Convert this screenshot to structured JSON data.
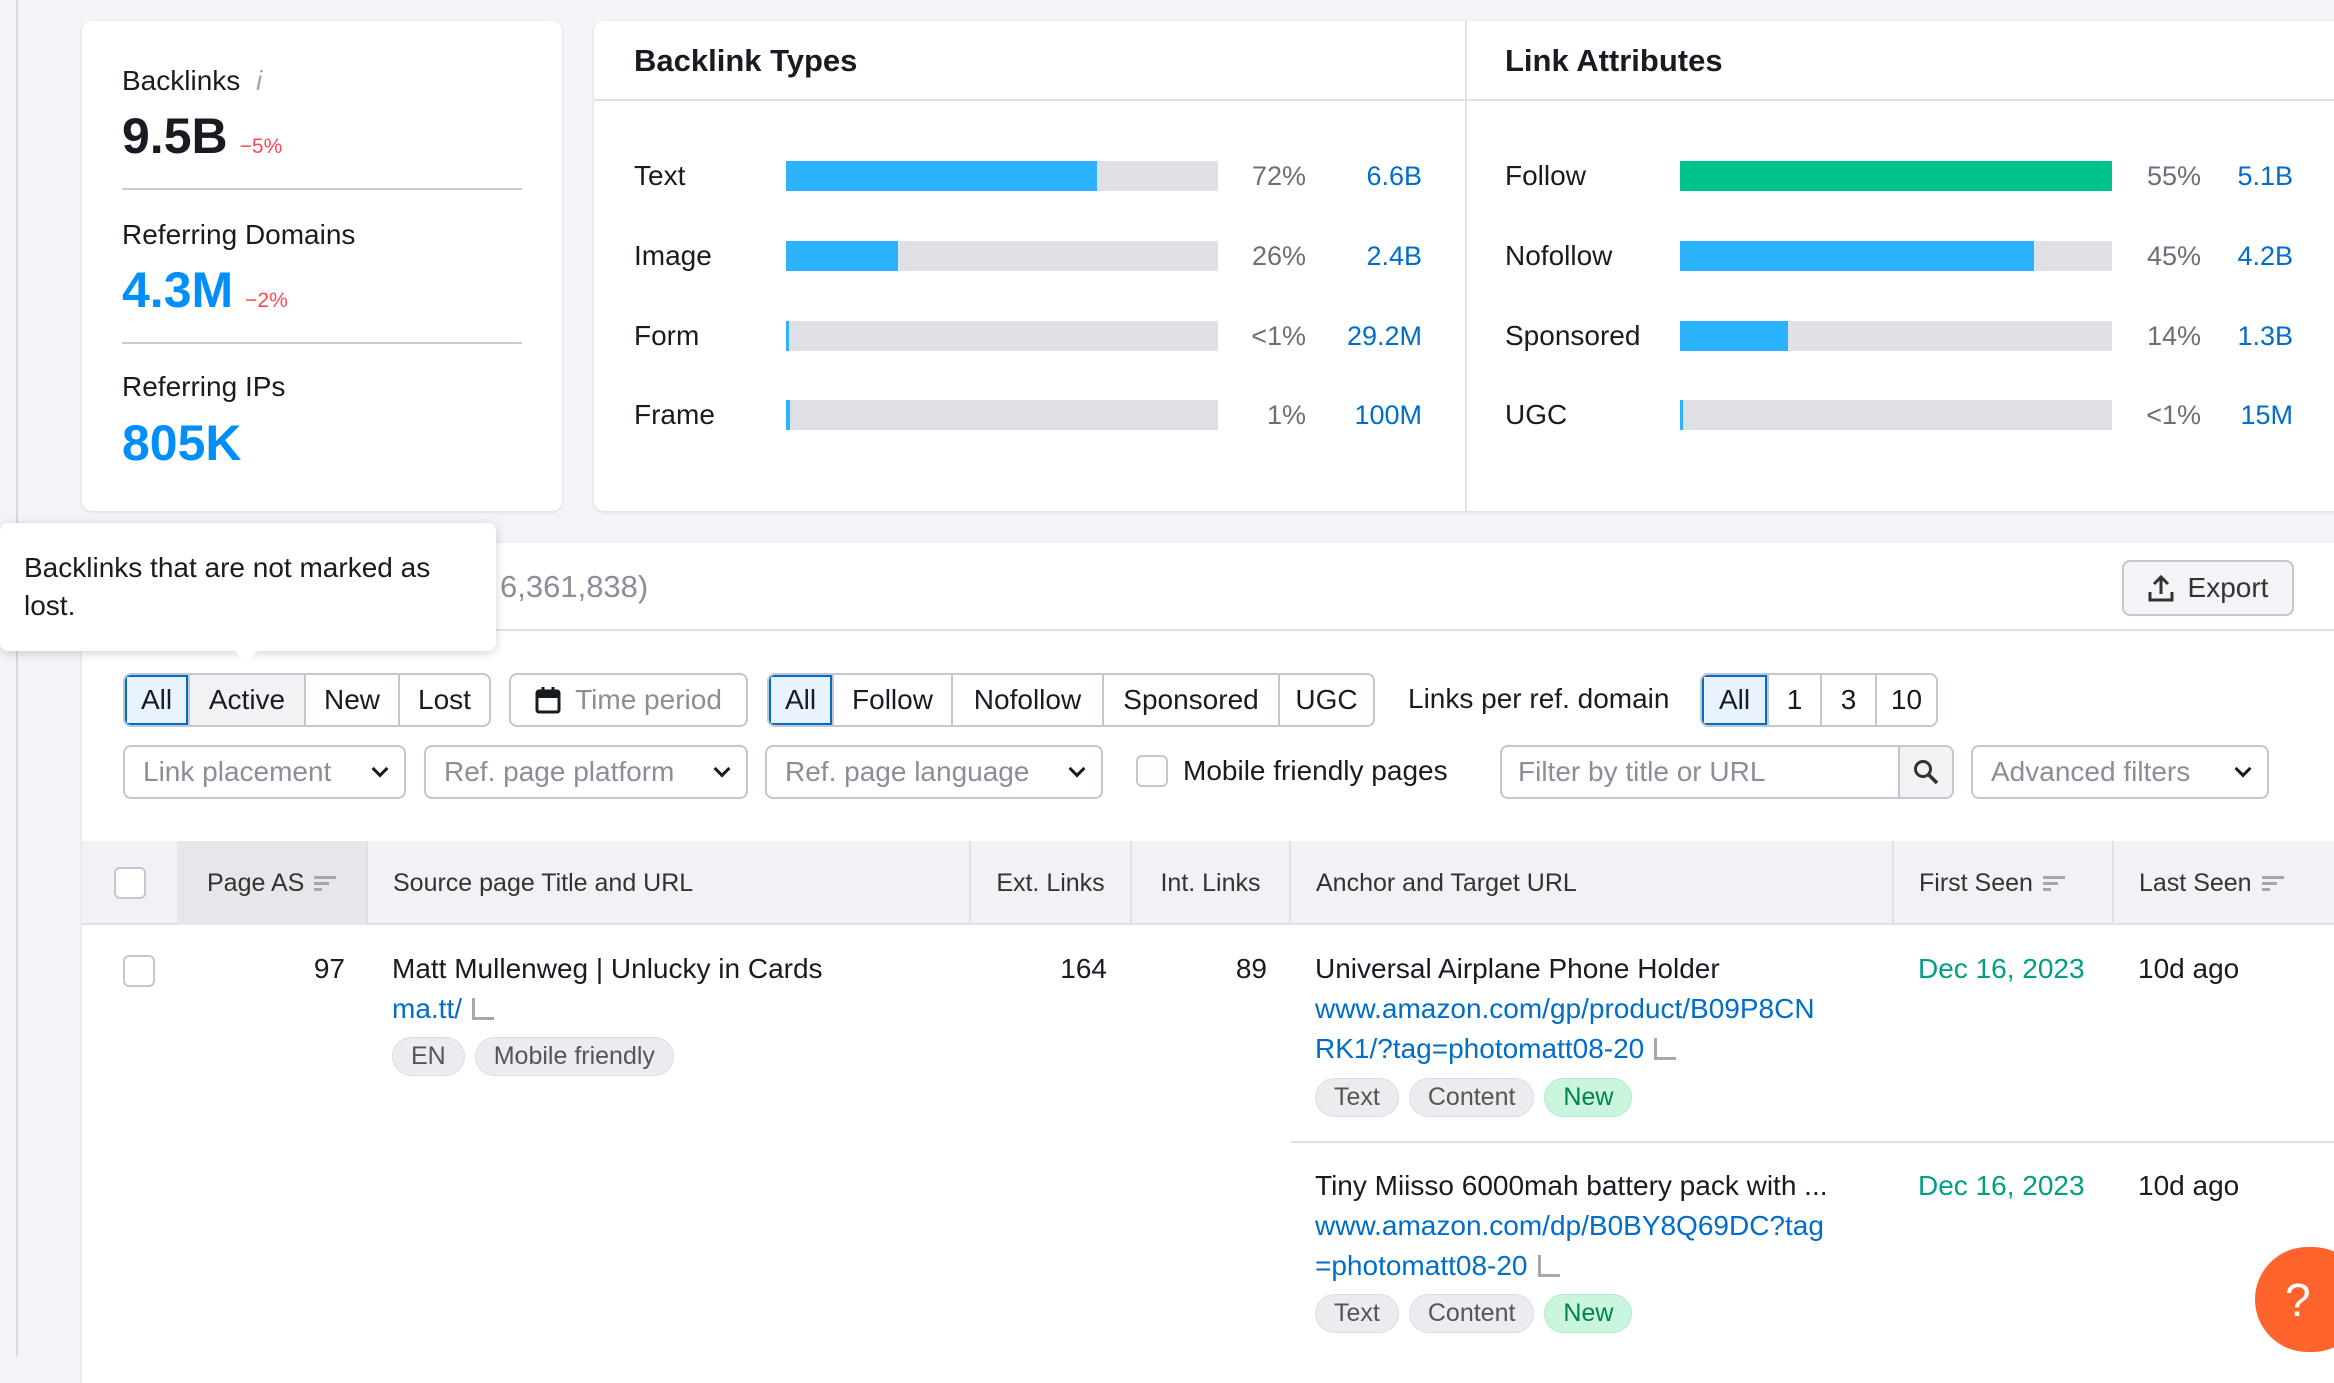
{
  "summary": {
    "backlinks": {
      "label": "Backlinks",
      "value": "9.5B",
      "delta": "−5%"
    },
    "referring_domains": {
      "label": "Referring Domains",
      "value": "4.3M",
      "delta": "−2%"
    },
    "referring_ips": {
      "label": "Referring IPs",
      "value": "805K"
    }
  },
  "backlink_types": {
    "title": "Backlink Types",
    "rows": [
      {
        "label": "Text",
        "percent_label": "72%",
        "value": "6.6B",
        "fill": 72
      },
      {
        "label": "Image",
        "percent_label": "26%",
        "value": "2.4B",
        "fill": 26
      },
      {
        "label": "Form",
        "percent_label": "<1%",
        "value": "29.2M",
        "fill": 0.5
      },
      {
        "label": "Frame",
        "percent_label": "1%",
        "value": "100M",
        "fill": 1
      }
    ]
  },
  "link_attributes": {
    "title": "Link Attributes",
    "rows": [
      {
        "label": "Follow",
        "percent_label": "55%",
        "value": "5.1B",
        "fill": 100,
        "color": "#00c38a"
      },
      {
        "label": "Nofollow",
        "percent_label": "45%",
        "value": "4.2B",
        "fill": 82,
        "color": "#2bb3ff"
      },
      {
        "label": "Sponsored",
        "percent_label": "14%",
        "value": "1.3B",
        "fill": 25,
        "color": "#2bb3ff"
      },
      {
        "label": "UGC",
        "percent_label": "<1%",
        "value": "15M",
        "fill": 0.5,
        "color": "#2bb3ff"
      }
    ]
  },
  "colors": {
    "bar_blue": "#2bb3ff",
    "bar_green": "#00c38a",
    "track": "#dfe0e5",
    "link": "#006dca",
    "help": "#ff642d"
  },
  "tooltip": "Backlinks that are not marked as lost.",
  "count_partial": "6,361,838)",
  "export_label": "Export",
  "filters": {
    "status": [
      "All",
      "Active",
      "New",
      "Lost"
    ],
    "time_period": "Time period",
    "attributes": [
      "All",
      "Follow",
      "Nofollow",
      "Sponsored",
      "UGC"
    ],
    "links_per_domain_label": "Links per ref. domain",
    "links_per_domain": [
      "All",
      "1",
      "3",
      "10"
    ],
    "link_placement": "Link placement",
    "ref_platform": "Ref. page platform",
    "ref_language": "Ref. page language",
    "mobile_friendly": "Mobile friendly pages",
    "search_placeholder": "Filter by title or URL",
    "advanced": "Advanced filters"
  },
  "table": {
    "columns": [
      "Page AS",
      "Source page Title and URL",
      "Ext. Links",
      "Int. Links",
      "Anchor and Target URL",
      "First Seen",
      "Last Seen"
    ],
    "rows": [
      {
        "page_as": "97",
        "source_title": "Matt Mullenweg | Unlucky in Cards",
        "source_url": "ma.tt/",
        "source_tags": [
          "EN",
          "Mobile friendly"
        ],
        "ext_links": "164",
        "int_links": "89",
        "anchors": [
          {
            "anchor": "Universal Airplane Phone Holder",
            "url_line1": "www.amazon.com/gp/product/B09P8CN",
            "url_line2": "RK1/?tag=photomatt08-20",
            "tags": [
              "Text",
              "Content",
              "New"
            ],
            "first_seen": "Dec 16, 2023",
            "last_seen": "10d ago"
          },
          {
            "anchor": "Tiny Miisso 6000mah battery pack with ...",
            "url_line1": "www.amazon.com/dp/B0BY8Q69DC?tag",
            "url_line2": "=photomatt08-20",
            "tags": [
              "Text",
              "Content",
              "New"
            ],
            "first_seen": "Dec 16, 2023",
            "last_seen": "10d ago"
          }
        ]
      }
    ]
  },
  "help_label": "?"
}
